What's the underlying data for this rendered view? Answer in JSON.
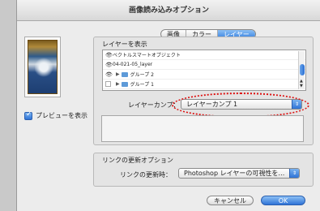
{
  "window": {
    "title": "画像読み込みオプション"
  },
  "preview": {
    "checkbox_label": "プレビューを表示",
    "checked": true
  },
  "tabs": [
    {
      "label": "画像",
      "active": false
    },
    {
      "label": "カラー",
      "active": false
    },
    {
      "label": "レイヤー",
      "active": true
    }
  ],
  "layers": {
    "group_label": "レイヤーを表示",
    "items": [
      {
        "label": "ベクトルスマートオブジェクト",
        "visible": true,
        "folder": false
      },
      {
        "label": "04-021-05_layer",
        "visible": true,
        "folder": false
      },
      {
        "label": "グループ 2",
        "visible": true,
        "folder": true
      },
      {
        "label": "グループ 1",
        "visible": false,
        "folder": true
      }
    ]
  },
  "layer_comp": {
    "label": "レイヤーカンプ：",
    "value": "レイヤーカンプ 1"
  },
  "link_update": {
    "group_label": "リンクの更新オプション",
    "label": "リンクの更新時：",
    "value": "Photoshop レイヤーの可視性を…"
  },
  "buttons": {
    "cancel": "キャンセル",
    "ok": "OK"
  },
  "colors": {
    "accent": "#2f73d6",
    "annotation_ring": "#dd1111"
  }
}
